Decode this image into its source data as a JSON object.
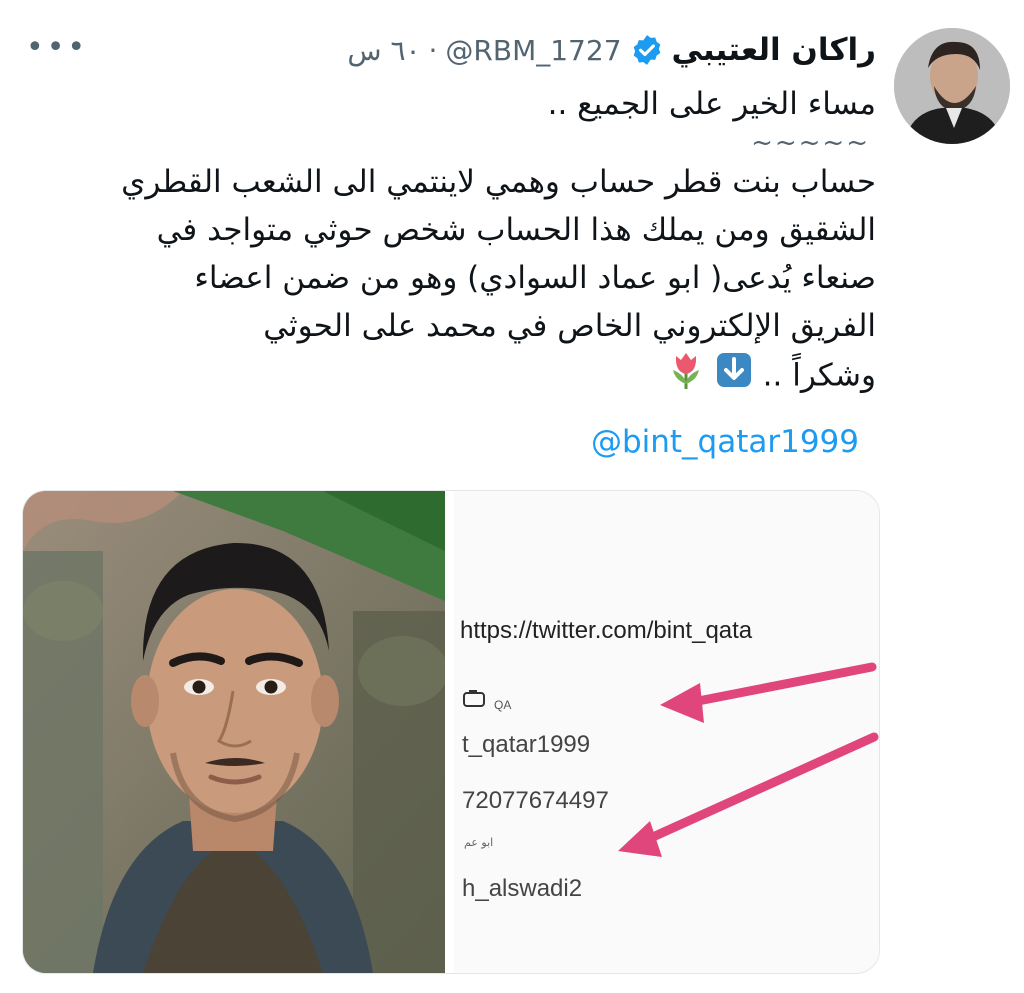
{
  "tweet": {
    "display_name": "راكان العتيبي",
    "handle": "@RBM_1727",
    "separator": "·",
    "time": "٦٠ س",
    "more_label": "•••",
    "lines": [
      "مساء الخير على الجميع ..",
      "~~~~~",
      "حساب بنت قطر حساب وهمي لاينتمي الى الشعب القطري",
      "الشقيق ومن يملك هذا الحساب شخص حوثي متواجد في",
      "صنعاء  يُدعى( ابو عماد السوادي) وهو من ضمن اعضاء",
      "الفريق الإلكتروني الخاص في محمد على الحوثي",
      "وشكراً .."
    ],
    "mention": "@bint_qatar1999",
    "icons": [
      "verified-badge-icon",
      "down-arrow-emoji",
      "tulip-emoji",
      "more-options-icon"
    ]
  },
  "media": {
    "screenshot": {
      "url_text": "https://twitter.com/bint_qata",
      "small_label": "QA",
      "username_fragment": "t_qatar1999",
      "id_fragment": "72077674497",
      "tiny_label": "ابو عم",
      "handle_fragment": "h_alswadi2"
    }
  },
  "colors": {
    "link": "#1d9bf0",
    "secondary_text": "#536471",
    "verified": "#1d9bf0",
    "arrow": "#e0457b"
  }
}
